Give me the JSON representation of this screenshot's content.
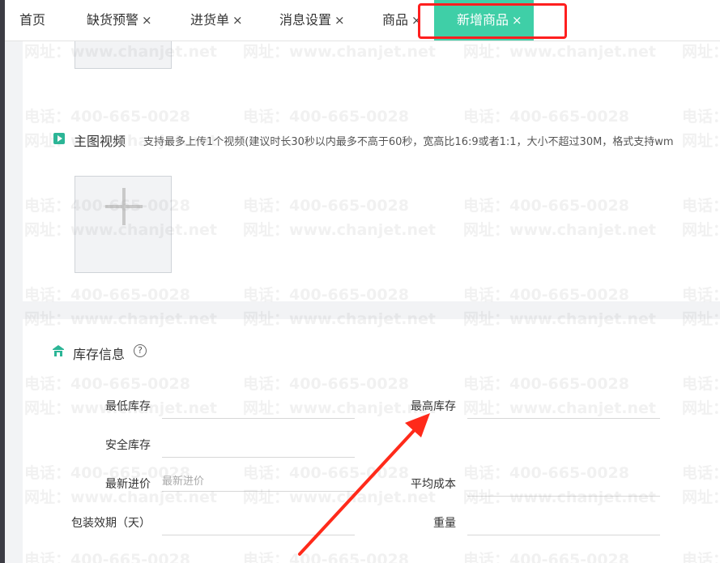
{
  "tabs": [
    {
      "label": "首页",
      "closable": false
    },
    {
      "label": "缺货预警",
      "closable": true
    },
    {
      "label": "进货单",
      "closable": true
    },
    {
      "label": "消息设置",
      "closable": true
    },
    {
      "label": "商品",
      "closable": true
    },
    {
      "label": "新增商品",
      "closable": true,
      "active": true
    }
  ],
  "close_glyph": "×",
  "video_section": {
    "title": "主图视频",
    "hint": "支持最多上传1个视频(建议时长30秒以内最多不高于60秒，宽高比16:9或者1:1，大小不超过30M，格式支持wm"
  },
  "inventory_section": {
    "title": "库存信息",
    "help_glyph": "?",
    "fields": {
      "min_stock": {
        "label": "最低库存",
        "value": ""
      },
      "max_stock": {
        "label": "最高库存",
        "value": ""
      },
      "safety_stock": {
        "label": "安全库存",
        "value": ""
      },
      "latest_purchase_price": {
        "label": "最新进价",
        "placeholder": "最新进价"
      },
      "average_cost": {
        "label": "平均成本",
        "value": ""
      },
      "shelf_life_days": {
        "label": "包装效期（天）",
        "value": ""
      },
      "weight": {
        "label": "重量",
        "value": ""
      }
    }
  },
  "watermark": {
    "phone": "电话：400-665-0028",
    "site": "网址：www.chanjet.net"
  },
  "colors": {
    "active_tab": "#3fcfa7",
    "highlight_box": "#ff1f1f",
    "section_icon": "#2bb596",
    "arrow": "#ff2a1a"
  }
}
